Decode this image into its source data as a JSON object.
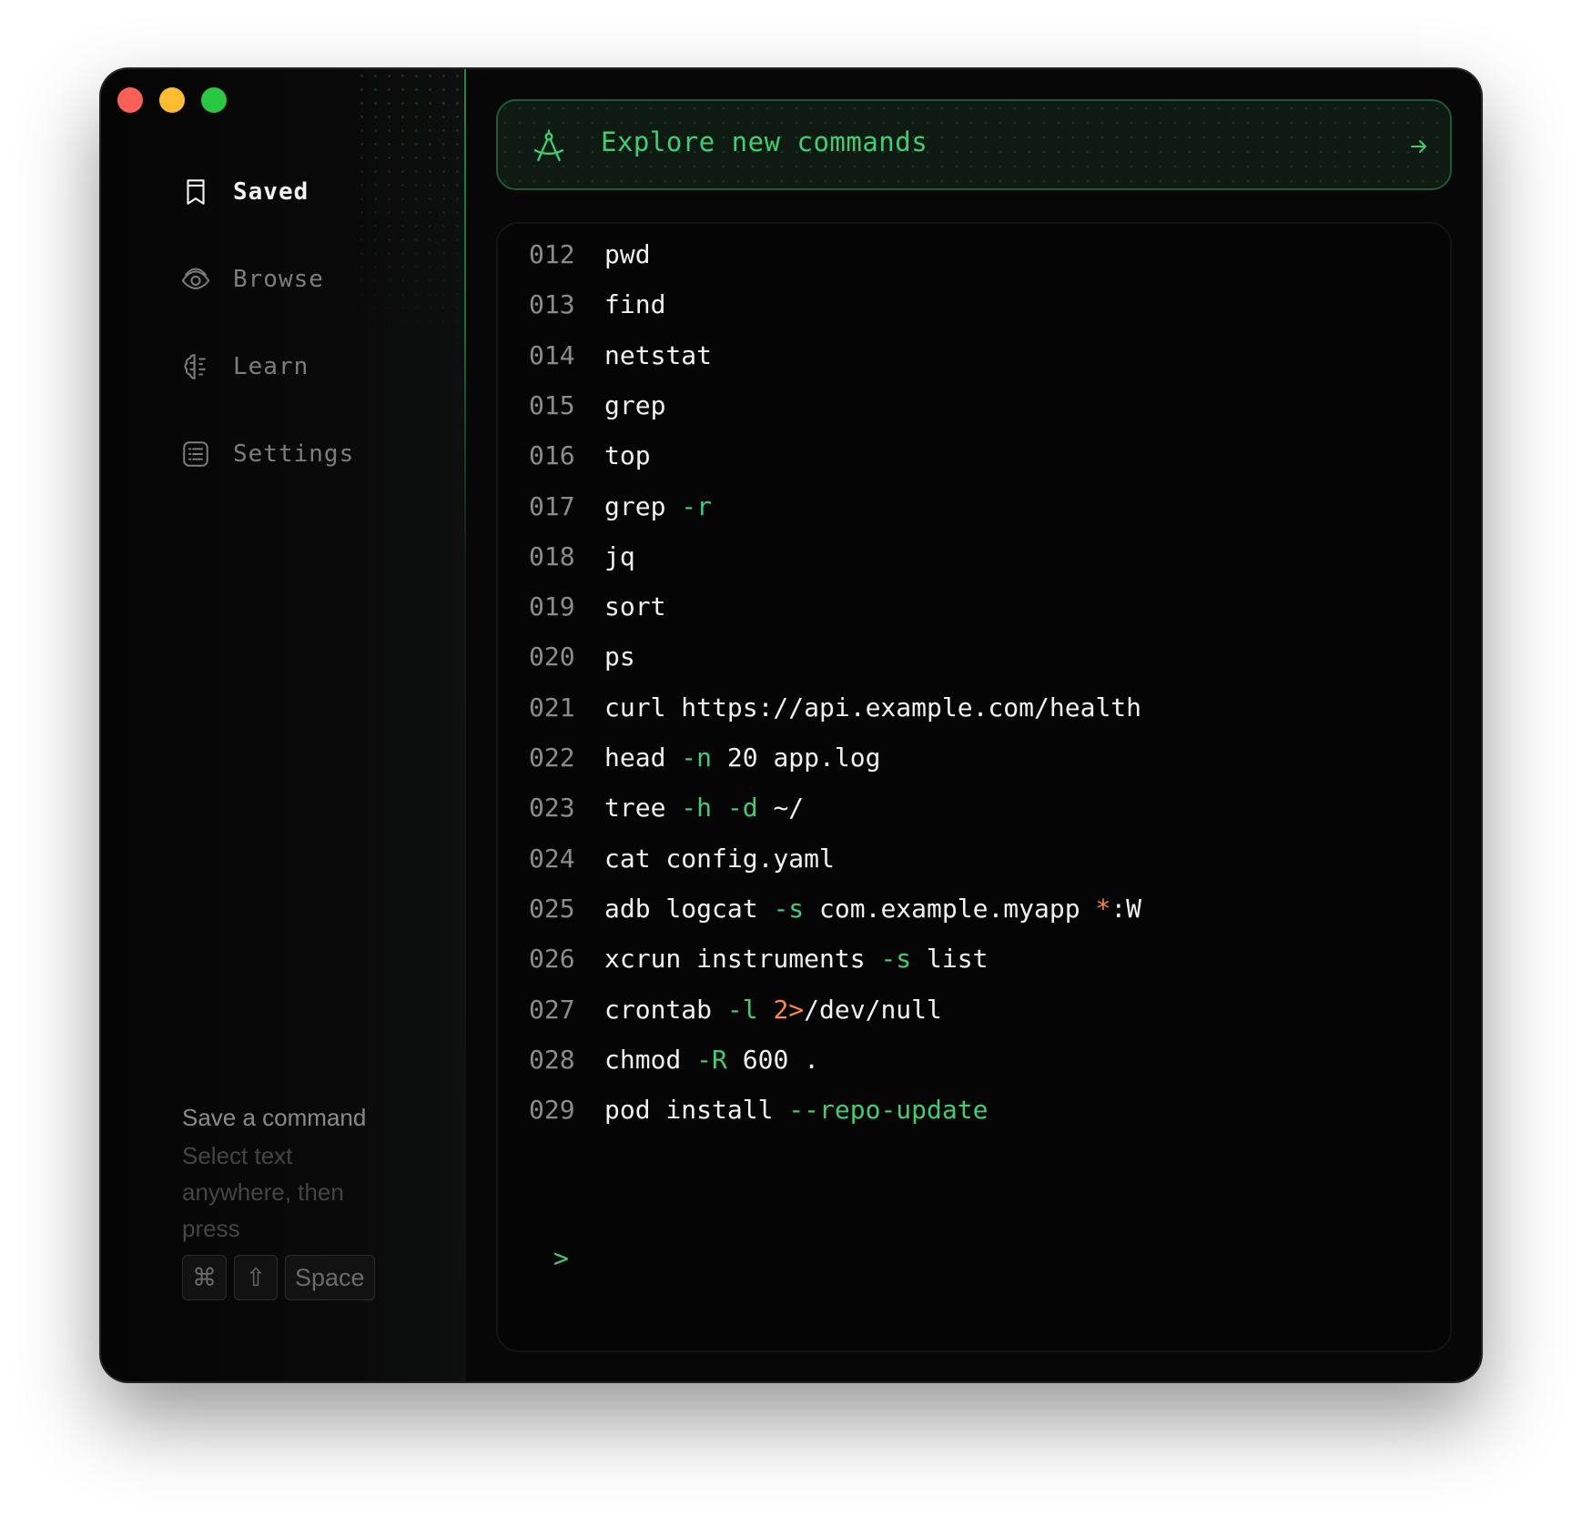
{
  "sidebar": {
    "items": [
      {
        "label": "Saved",
        "icon": "bookmark-icon",
        "active": true
      },
      {
        "label": "Browse",
        "icon": "eye-icon",
        "active": false
      },
      {
        "label": "Learn",
        "icon": "brain-icon",
        "active": false
      },
      {
        "label": "Settings",
        "icon": "list-icon",
        "active": false
      }
    ],
    "hint": {
      "title": "Save a command",
      "body": "Select text anywhere, then press",
      "keys": [
        "⌘",
        "⇧",
        "Space"
      ]
    }
  },
  "banner": {
    "label": "Explore new commands",
    "icon": "compass-icon",
    "arrow": "arrow-right-icon"
  },
  "terminal": {
    "lines": [
      {
        "num": "012",
        "parts": [
          {
            "t": "pwd",
            "c": "cmd"
          }
        ]
      },
      {
        "num": "013",
        "parts": [
          {
            "t": "find",
            "c": "cmd"
          }
        ]
      },
      {
        "num": "014",
        "parts": [
          {
            "t": "netstat",
            "c": "cmd"
          }
        ]
      },
      {
        "num": "015",
        "parts": [
          {
            "t": "grep",
            "c": "cmd"
          }
        ]
      },
      {
        "num": "016",
        "parts": [
          {
            "t": "top",
            "c": "cmd"
          }
        ]
      },
      {
        "num": "017",
        "parts": [
          {
            "t": "grep ",
            "c": "cmd"
          },
          {
            "t": "-r",
            "c": "flag"
          }
        ]
      },
      {
        "num": "018",
        "parts": [
          {
            "t": "jq",
            "c": "cmd"
          }
        ]
      },
      {
        "num": "019",
        "parts": [
          {
            "t": "sort",
            "c": "cmd"
          }
        ]
      },
      {
        "num": "020",
        "parts": [
          {
            "t": "ps",
            "c": "cmd"
          }
        ]
      },
      {
        "num": "021",
        "parts": [
          {
            "t": "curl https://api.example.com/health",
            "c": "cmd"
          }
        ]
      },
      {
        "num": "022",
        "parts": [
          {
            "t": "head ",
            "c": "cmd"
          },
          {
            "t": "-n",
            "c": "flag"
          },
          {
            "t": " 20 app.log",
            "c": "cmd"
          }
        ]
      },
      {
        "num": "023",
        "parts": [
          {
            "t": "tree ",
            "c": "cmd"
          },
          {
            "t": "-h",
            "c": "flag"
          },
          {
            "t": " ",
            "c": "cmd"
          },
          {
            "t": "-d",
            "c": "flag"
          },
          {
            "t": " ~/",
            "c": "cmd"
          }
        ]
      },
      {
        "num": "024",
        "parts": [
          {
            "t": "cat config.yaml",
            "c": "cmd"
          }
        ]
      },
      {
        "num": "025",
        "parts": [
          {
            "t": "adb logcat ",
            "c": "cmd"
          },
          {
            "t": "-s",
            "c": "flag"
          },
          {
            "t": " com.example.myapp ",
            "c": "cmd"
          },
          {
            "t": "*",
            "c": "orange"
          },
          {
            "t": ":W",
            "c": "cmd"
          }
        ]
      },
      {
        "num": "026",
        "parts": [
          {
            "t": "xcrun instruments ",
            "c": "cmd"
          },
          {
            "t": "-s",
            "c": "flag"
          },
          {
            "t": " list",
            "c": "cmd"
          }
        ]
      },
      {
        "num": "027",
        "parts": [
          {
            "t": "crontab ",
            "c": "cmd"
          },
          {
            "t": "-l",
            "c": "flag"
          },
          {
            "t": " ",
            "c": "cmd"
          },
          {
            "t": "2>",
            "c": "orange"
          },
          {
            "t": "/dev/null",
            "c": "cmd"
          }
        ]
      },
      {
        "num": "028",
        "parts": [
          {
            "t": "chmod ",
            "c": "cmd"
          },
          {
            "t": "-R",
            "c": "flag"
          },
          {
            "t": " 600 .",
            "c": "cmd"
          }
        ]
      },
      {
        "num": "029",
        "parts": [
          {
            "t": "pod install ",
            "c": "cmd"
          },
          {
            "t": "--repo-update",
            "c": "flag"
          }
        ]
      }
    ],
    "prompt": ">"
  },
  "colors": {
    "accent": "#3ecf74",
    "orange": "#ff8a3d",
    "background": "#070707"
  }
}
